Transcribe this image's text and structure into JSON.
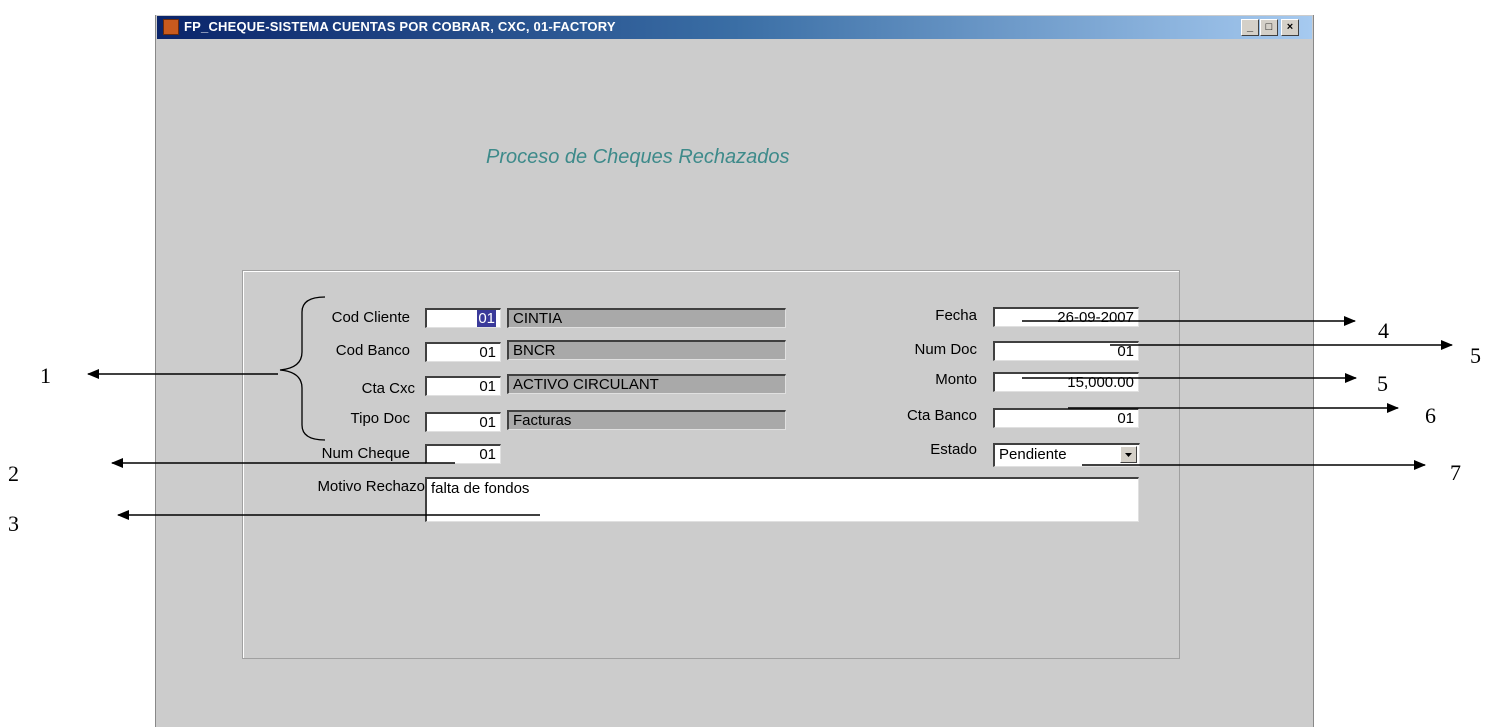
{
  "window": {
    "title": "FP_CHEQUE-SISTEMA CUENTAS POR COBRAR, CXC, 01-FACTORY",
    "minimize": "_",
    "maximize": "□",
    "close": "×"
  },
  "form": {
    "heading": "Proceso de Cheques Rechazados",
    "cod_cliente": {
      "label": "Cod Cliente",
      "code": "01",
      "name": "CINTIA"
    },
    "cod_banco": {
      "label": "Cod Banco",
      "code": "01",
      "name": "BNCR"
    },
    "cta_cxc": {
      "label": "Cta Cxc",
      "code": "01",
      "name": "ACTIVO CIRCULANT"
    },
    "tipo_doc": {
      "label": "Tipo Doc",
      "code": "01",
      "name": "Facturas"
    },
    "num_cheque": {
      "label": "Num Cheque",
      "value": "01"
    },
    "motivo_rechazo": {
      "label": "Motivo Rechazo",
      "value": "falta de fondos"
    },
    "fecha": {
      "label": "Fecha",
      "value": "26-09-2007"
    },
    "num_doc": {
      "label": "Num Doc",
      "value": "01"
    },
    "monto": {
      "label": "Monto",
      "value": "15,000.00"
    },
    "cta_banco": {
      "label": "Cta Banco",
      "value": "01"
    },
    "estado": {
      "label": "Estado",
      "value": "Pendiente"
    }
  },
  "annotations": {
    "n1": "1",
    "n2": "2",
    "n3": "3",
    "n4": "4",
    "n5a": "5",
    "n5b": "5",
    "n6": "6",
    "n7": "7"
  },
  "colors": {
    "window_bg": "#cccccc",
    "titlebar_start": "#0a246a",
    "titlebar_end": "#a6caf0",
    "heading": "#3d8a8a",
    "readonly_field": "#a9a9a9"
  }
}
